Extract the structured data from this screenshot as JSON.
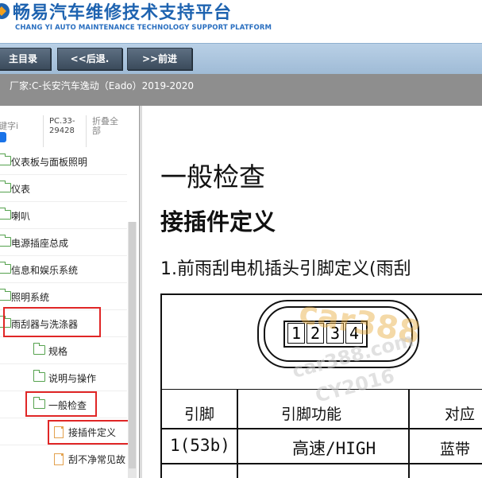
{
  "header": {
    "title": "畅易汽车维修技术支持平台",
    "subtitle": "CHANG YI AUTO MAINTENANCE TECHNOLOGY SUPPORT PLATFORM"
  },
  "nav": {
    "home_label": "主目录",
    "back_label": "<<后退.",
    "forward_label": ">>前进"
  },
  "info": {
    "vehicle": "厂家:C-长安汽车逸动（Eado）2019-2020"
  },
  "sidebar": {
    "search_hint": "键字i",
    "pc_code_line1": "PC.33-",
    "pc_code_line2": "29428",
    "collapse_line1": "折叠全",
    "collapse_line2": "部",
    "items": [
      {
        "label": "仪表板与面板照明"
      },
      {
        "label": "仪表"
      },
      {
        "label": "喇叭"
      },
      {
        "label": "电源插座总成"
      },
      {
        "label": "信息和娱乐系统"
      },
      {
        "label": "照明系统"
      },
      {
        "label": "雨刮器与洗涤器"
      },
      {
        "label": "规格"
      },
      {
        "label": "说明与操作"
      },
      {
        "label": "一般检查"
      },
      {
        "label": "接插件定义"
      },
      {
        "label": "刮不净常见故"
      }
    ]
  },
  "content": {
    "title": "一般检查",
    "section": "接插件定义",
    "subsection": "1.前雨刮电机插头引脚定义(雨刮",
    "pins": [
      "1",
      "2",
      "3",
      "4"
    ],
    "table": {
      "headers": [
        "引脚",
        "引脚功能",
        "对应"
      ],
      "row1": [
        "1(53b)",
        "高速/HIGH",
        "蓝带"
      ]
    }
  },
  "watermarks": [
    "car388",
    "car388.com",
    "CY2016"
  ],
  "colors": {
    "brand": "#1e63b0",
    "nav_button": "#4a5b6d",
    "info_bar": "#8e8e8e",
    "highlight": "#e02626",
    "folder": "#55a24e",
    "doc": "#e3a14e"
  }
}
